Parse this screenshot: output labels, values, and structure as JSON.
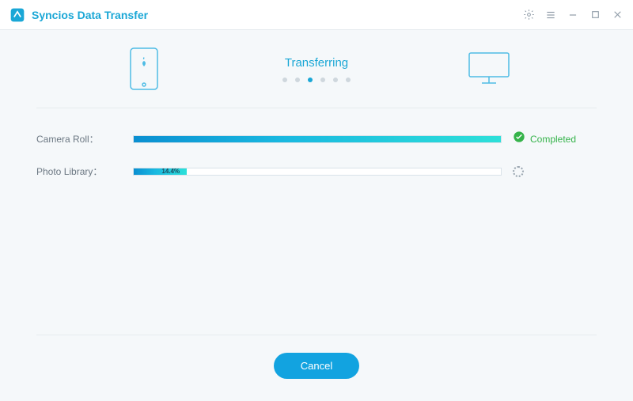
{
  "app": {
    "title": "Syncios Data Transfer"
  },
  "header": {
    "title": "Transferring",
    "dots": {
      "total": 6,
      "active_index": 2
    }
  },
  "items": [
    {
      "label": "Camera Roll：",
      "percent": 100,
      "percent_text": "",
      "status": "completed",
      "status_text": "Completed"
    },
    {
      "label": "Photo Library：",
      "percent": 14.4,
      "percent_text": "14.4%",
      "status": "running",
      "status_text": ""
    }
  ],
  "footer": {
    "cancel_label": "Cancel"
  },
  "icons": {
    "source_device": "phone-apple-icon",
    "target_device": "monitor-icon"
  }
}
